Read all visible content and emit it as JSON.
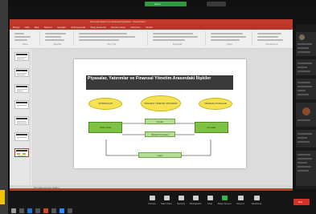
{
  "zoom": {
    "title_bar": "Zoom",
    "controls": [
      {
        "label": "Unmute"
      },
      {
        "label": "Start Video"
      },
      {
        "label": "Security"
      },
      {
        "label": "Participants"
      },
      {
        "label": "Chat"
      },
      {
        "label": "Share Screen"
      },
      {
        "label": "Record"
      },
      {
        "label": "Reactions"
      }
    ],
    "leave_label": "End"
  },
  "ppt": {
    "window_title": "Finansal Sistem ve Finansal Piyasalar - PowerPoint",
    "menu": [
      "Dosya",
      "Giriş",
      "Ekle",
      "Tasarım",
      "Geçişler",
      "Animasyonlar",
      "Slayt Gösterisi",
      "Gözden Geçir",
      "Görünüm",
      "Yardım"
    ],
    "ribbon_groups": [
      "Pano",
      "Slaytlar",
      "Yazı Tipi",
      "Paragraf",
      "Çizim",
      "Düzenleme"
    ],
    "notes_placeholder": "Not eklemek için tıklatın"
  },
  "slide": {
    "title": "Piyasalar, Yatırımlar ve Finansal Yönetim Arasındaki İlişkiler",
    "ellipses": [
      {
        "text": "YATIRIMCILAR"
      },
      {
        "text": "FİNANSAL YÖNETİM / FİNANSÖR"
      },
      {
        "text": "FİNANSAL PİYASALAR"
      }
    ],
    "left_box": "Yatırımcılar",
    "right_box": "Firmalar",
    "mid_top_box": "Fonlar",
    "mid_center_box": "Menkul Kıymetler",
    "mid_bottom_box": "Getiri"
  }
}
